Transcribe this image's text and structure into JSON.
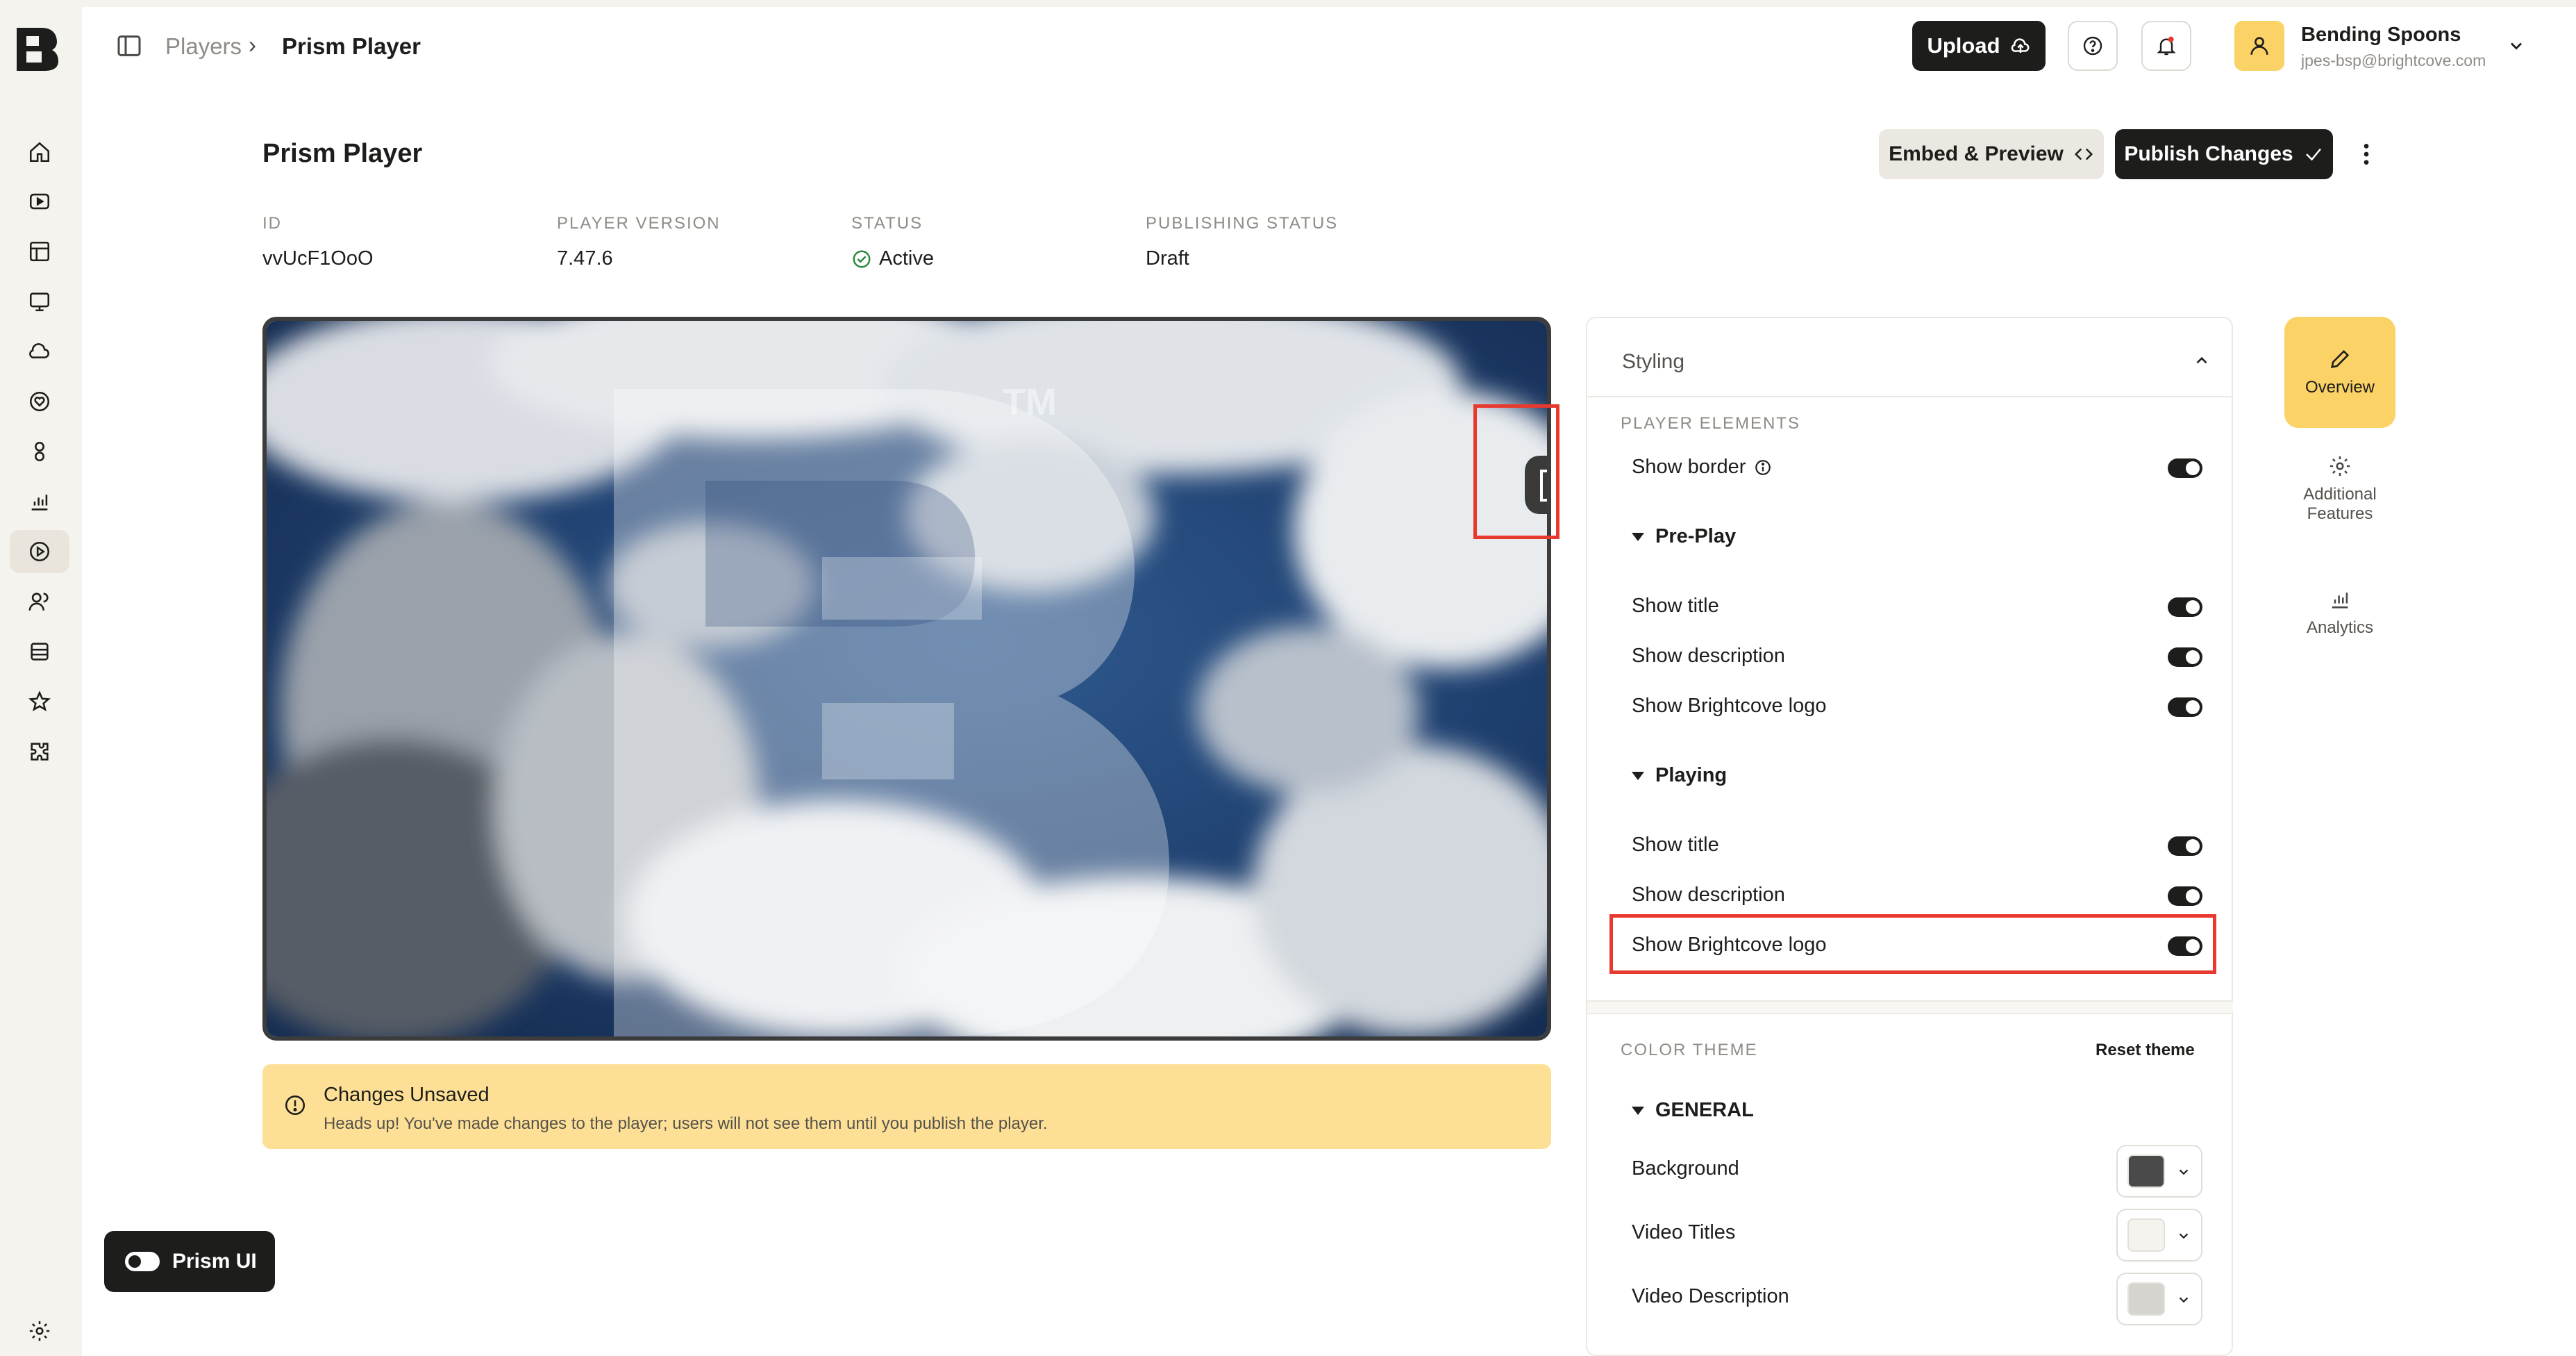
{
  "breadcrumb": {
    "parent": "Players",
    "separator": "›",
    "current": "Prism Player"
  },
  "topbar": {
    "upload_label": "Upload",
    "account_name": "Bending Spoons",
    "account_email": "jpes-bsp@brightcove.com"
  },
  "page": {
    "title": "Prism Player",
    "embed_label": "Embed & Preview",
    "publish_label": "Publish Changes"
  },
  "meta": {
    "id_label": "ID",
    "id_value": "vvUcF1OoO",
    "version_label": "PLAYER VERSION",
    "version_value": "7.47.6",
    "status_label": "STATUS",
    "status_value": "Active",
    "publishing_label": "PUBLISHING STATUS",
    "publishing_value": "Draft"
  },
  "video": {
    "tm": "TM"
  },
  "warning": {
    "title": "Changes Unsaved",
    "text": "Heads up! You've made changes to the player; users will not see them until you publish the player."
  },
  "prism": {
    "label": "Prism UI"
  },
  "styling": {
    "title": "Styling",
    "player_elements_label": "PLAYER ELEMENTS",
    "show_border": "Show border",
    "preplay_label": "Pre-Play",
    "preplay_items": [
      "Show title",
      "Show description",
      "Show Brightcove logo"
    ],
    "playing_label": "Playing",
    "playing_items": [
      "Show title",
      "Show description",
      "Show Brightcove logo"
    ],
    "color_theme_label": "COLOR THEME",
    "reset_label": "Reset theme",
    "general_label": "GENERAL",
    "colors": [
      {
        "label": "Background",
        "value": "#4a4a4a"
      },
      {
        "label": "Video Titles",
        "value": "#f5f3ee"
      },
      {
        "label": "Video Description",
        "value": "#d6d4cf"
      }
    ]
  },
  "rail": {
    "overview": "Overview",
    "additional_features": "Additional Features",
    "analytics": "Analytics"
  },
  "colors": {
    "accent": "#fbd266",
    "highlight": "#e8392f",
    "dark": "#1d1d1b"
  }
}
